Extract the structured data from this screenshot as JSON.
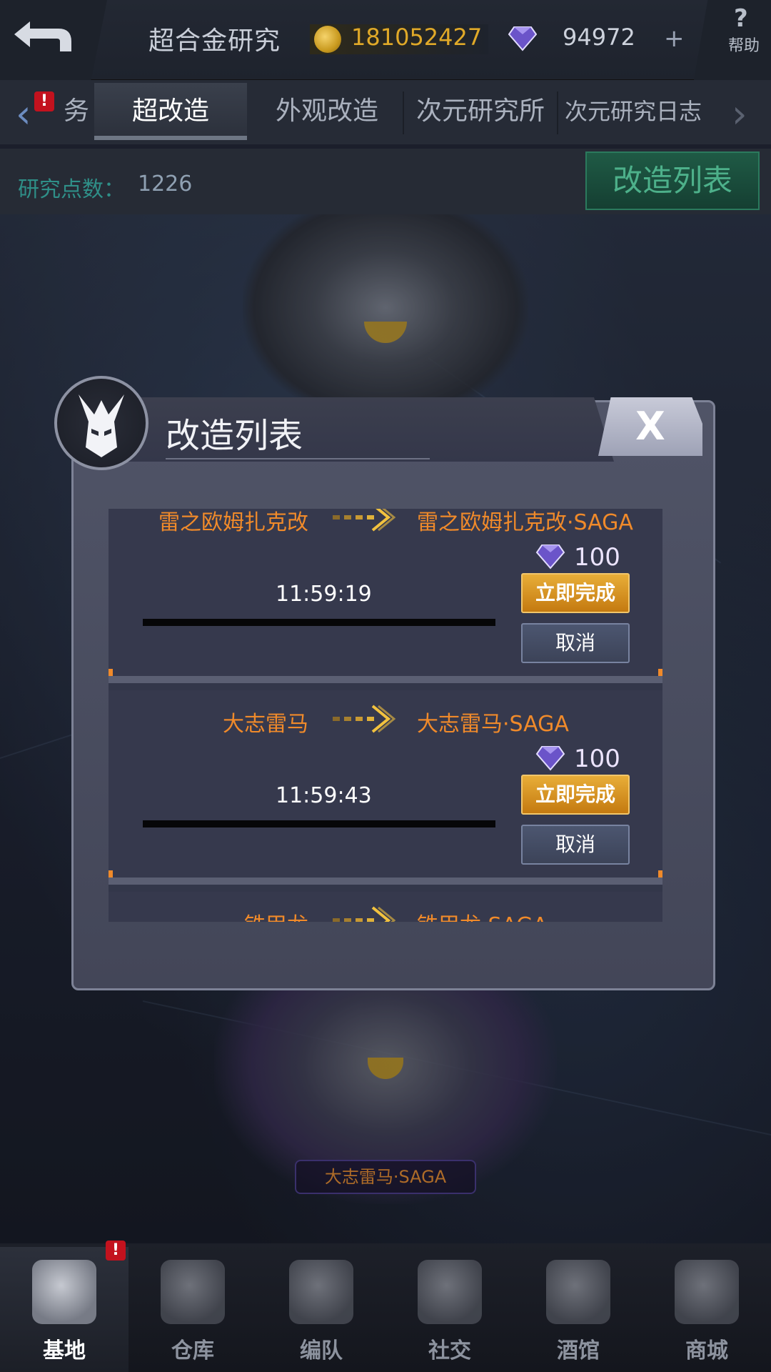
{
  "colors": {
    "accent_orange": "#f08a2a",
    "gold": "#e0a928",
    "complete_button": "#d8931f",
    "teal_label": "#2f8f88",
    "alert_red": "#c3121e"
  },
  "topbar": {
    "back_icon": "back-arrow-icon",
    "title": "超合金研究",
    "coin_icon": "gold-coin-icon",
    "coins": "181052427",
    "gem_icon": "diamond-icon",
    "gems": "94972",
    "plus": "+",
    "help_icon": "?",
    "help_label": "帮助"
  },
  "tabs": {
    "left_arrow": "‹",
    "right_arrow": "›",
    "alert_badge": "!",
    "items": [
      {
        "label": "务"
      },
      {
        "label": "超改造"
      },
      {
        "label": "外观改造"
      },
      {
        "label": "次元研究所"
      },
      {
        "label": "次元研究日志"
      }
    ]
  },
  "research": {
    "label": "研究点数：",
    "value": "1226",
    "list_button": "改造列表"
  },
  "modal": {
    "title": "改造列表",
    "close_label": "X",
    "items": [
      {
        "from": "雷之欧姆扎克改",
        "to": "雷之欧姆扎克改·SAGA",
        "cost": "100",
        "time": "11:59:19",
        "complete_label": "立即完成",
        "cancel_label": "取消"
      },
      {
        "from": "大志雷马",
        "to": "大志雷马·SAGA",
        "cost": "100",
        "time": "11:59:43",
        "complete_label": "立即完成",
        "cancel_label": "取消"
      },
      {
        "from": "铁甲龙",
        "to": "铁甲龙·SAGA"
      }
    ]
  },
  "scene": {
    "mech_name": "大志雷马·SAGA"
  },
  "bottom_nav": {
    "alert_badge": "!",
    "items": [
      {
        "label": "基地",
        "icon": "base-star-icon"
      },
      {
        "label": "仓库",
        "icon": "warehouse-icon"
      },
      {
        "label": "编队",
        "icon": "formation-helmet-icon"
      },
      {
        "label": "社交",
        "icon": "handshake-icon"
      },
      {
        "label": "酒馆",
        "icon": "tavern-mug-icon"
      },
      {
        "label": "商城",
        "icon": "shop-icon"
      }
    ]
  }
}
